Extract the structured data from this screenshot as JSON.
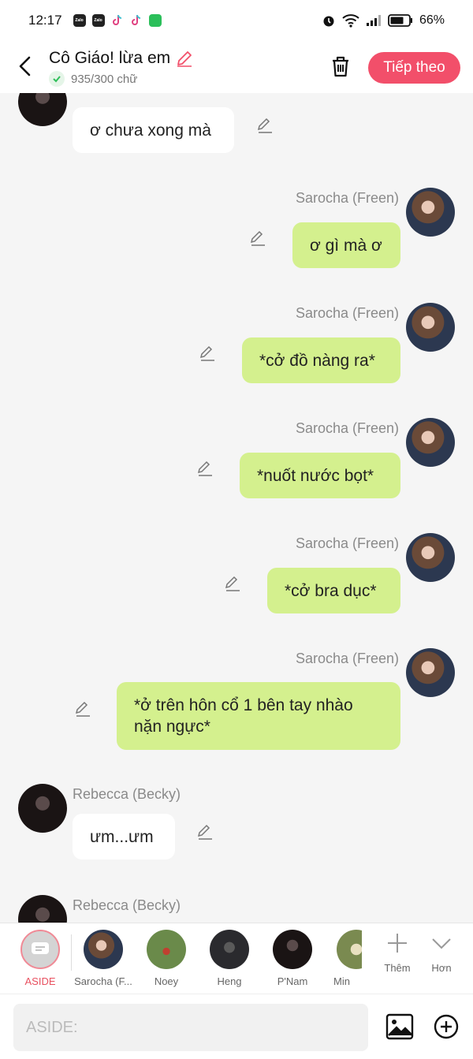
{
  "status_bar": {
    "time": "12:17",
    "battery": "66%",
    "apps": [
      {
        "name": "zalo-icon",
        "label": "Zalo",
        "color": "#222222"
      },
      {
        "name": "zalo-icon",
        "label": "Zalo",
        "color": "#222222"
      },
      {
        "name": "tiktok-icon",
        "label": "",
        "color": "#ffffff"
      },
      {
        "name": "tiktok-icon",
        "label": "",
        "color": "#ffffff"
      },
      {
        "name": "messages-icon",
        "label": "",
        "color": "#2bbf5a"
      }
    ]
  },
  "header": {
    "title": "Cô Giáo! lừa em",
    "word_count": "935/300 chữ",
    "next_label": "Tiếp theo",
    "accent": "#f24f6a"
  },
  "messages": [
    {
      "side": "left",
      "name": "",
      "text": "ơ chưa xong mà"
    },
    {
      "side": "right",
      "name": "Sarocha (Freen)",
      "text": "ơ gì mà ơ"
    },
    {
      "side": "right",
      "name": "Sarocha (Freen)",
      "text": "*cở đồ nàng ra*"
    },
    {
      "side": "right",
      "name": "Sarocha (Freen)",
      "text": "*nuốt nước bọt*"
    },
    {
      "side": "right",
      "name": "Sarocha (Freen)",
      "text": "*cở bra dục*"
    },
    {
      "side": "right",
      "name": "Sarocha (Freen)",
      "text": "*ở trên hôn cổ 1 bên tay nhào nặn ngực*"
    },
    {
      "side": "left",
      "name": "Rebecca (Becky)",
      "text": "ưm...ưm"
    },
    {
      "side": "left",
      "name": "Rebecca (Becky)",
      "text": ""
    }
  ],
  "character_bar": {
    "aside_label": "ASIDE",
    "characters": [
      {
        "label": "Sarocha (F..."
      },
      {
        "label": "Noey"
      },
      {
        "label": "Heng"
      },
      {
        "label": "P'Nam"
      },
      {
        "label": "Min"
      }
    ],
    "add_label": "Thêm",
    "more_label": "Hơn"
  },
  "input": {
    "placeholder": "ASIDE:"
  },
  "colors": {
    "bubble_right": "#d4f08e",
    "bubble_left": "#ffffff",
    "name_text": "#8a8a8a"
  }
}
